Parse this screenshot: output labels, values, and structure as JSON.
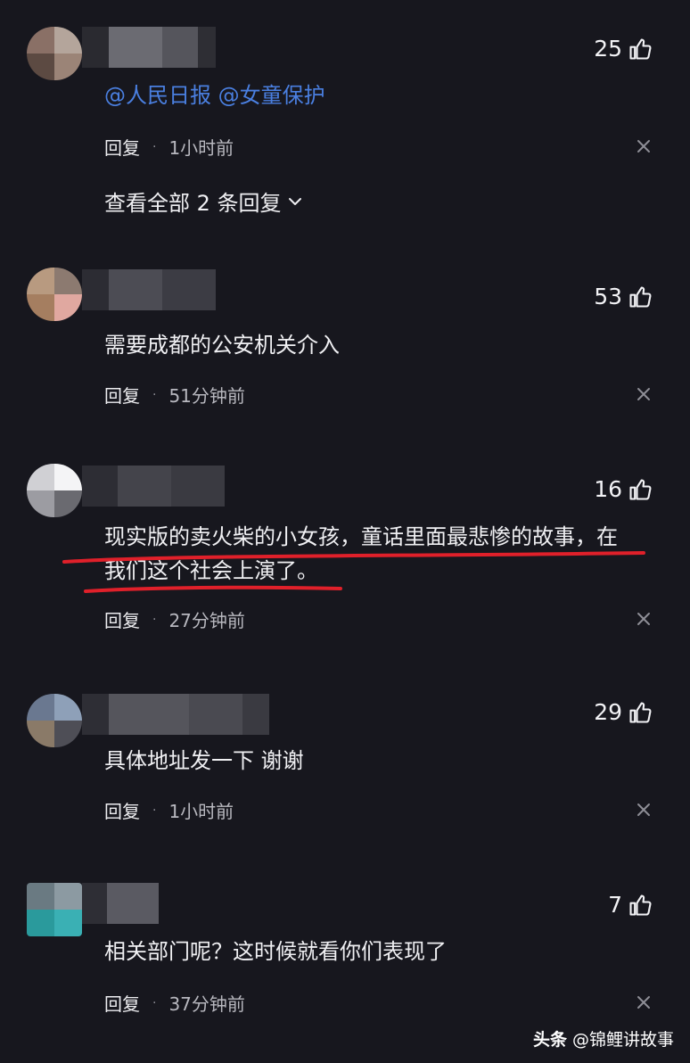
{
  "comments": [
    {
      "likes": "25",
      "mention": "@人民日报 @女童保护",
      "reply_label": "回复",
      "separator": "·",
      "time": "1小时前",
      "view_all": "查看全部 2 条回复"
    },
    {
      "likes": "53",
      "text": "需要成都的公安机关介入",
      "reply_label": "回复",
      "separator": "·",
      "time": "51分钟前"
    },
    {
      "likes": "16",
      "text_line1": "现实版的卖火柴的小女孩，童话里面最悲惨的故事，在",
      "text_line2": "我们这个社会上演了。",
      "reply_label": "回复",
      "separator": "·",
      "time": "27分钟前"
    },
    {
      "likes": "29",
      "text": "具体地址发一下 谢谢",
      "reply_label": "回复",
      "separator": "·",
      "time": "1小时前"
    },
    {
      "likes": "7",
      "text": "相关部门呢？这时候就看你们表现了",
      "reply_label": "回复",
      "separator": "·",
      "time": "37分钟前"
    }
  ],
  "watermark": {
    "brand": "头条",
    "handle": "@锦鲤讲故事"
  },
  "colors": {
    "background": "#17171e",
    "mention": "#4a7fe0",
    "annotation_underline": "#e0202a"
  },
  "icons": [
    "thumbs-up-icon",
    "close-icon",
    "chevron-down-icon"
  ]
}
